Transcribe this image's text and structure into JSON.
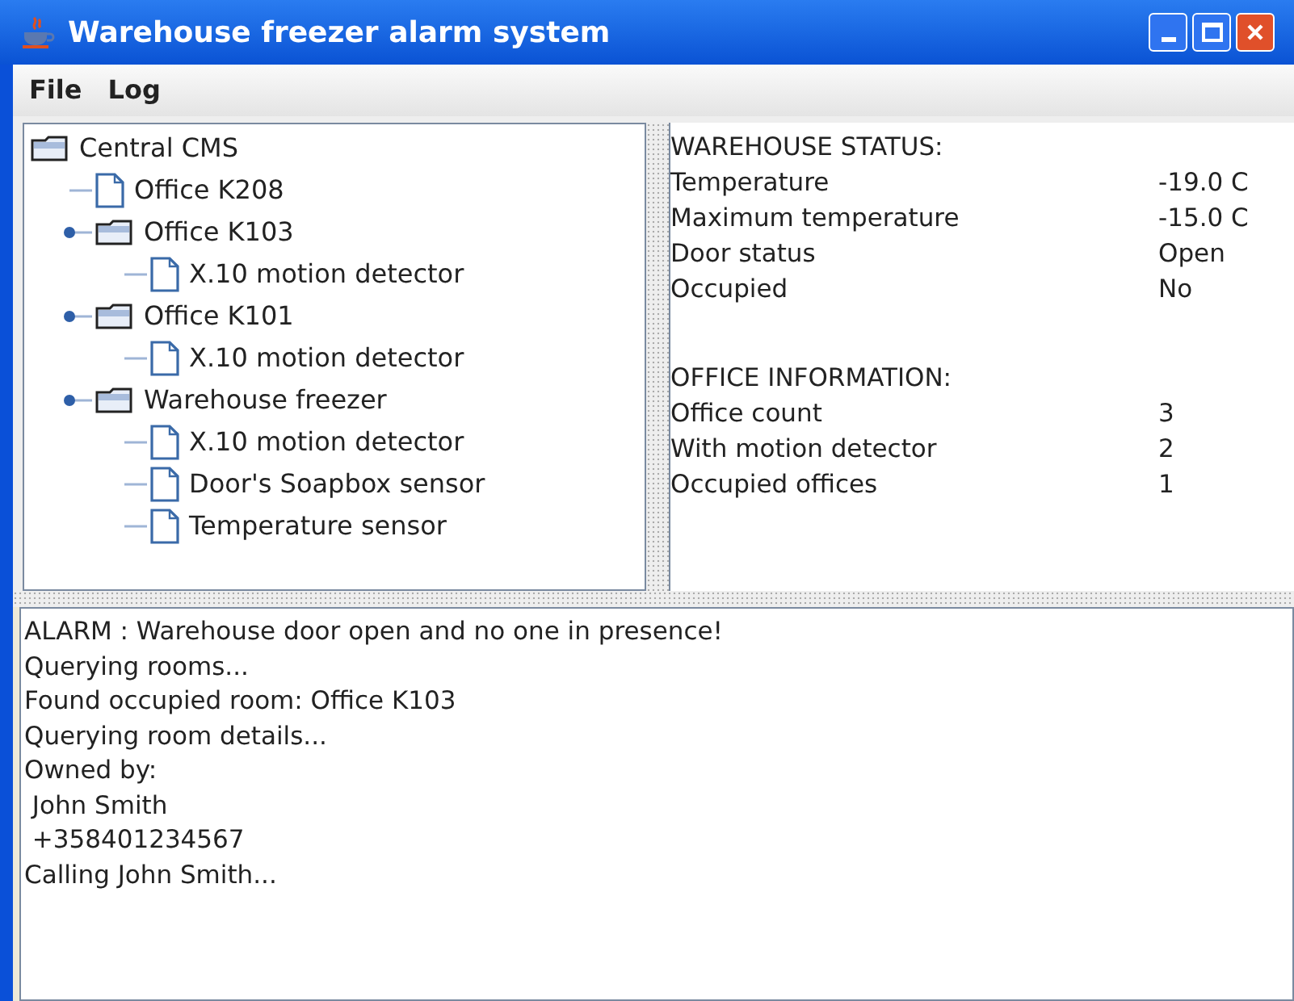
{
  "window": {
    "title": "Warehouse freezer alarm system"
  },
  "menu": [
    "File",
    "Log"
  ],
  "tree": [
    {
      "label": "Central CMS",
      "kind": "folder",
      "children": [
        {
          "label": "Office K208",
          "kind": "file"
        },
        {
          "label": "Office K103",
          "kind": "folder",
          "children": [
            {
              "label": "X.10 motion detector",
              "kind": "file"
            }
          ]
        },
        {
          "label": "Office K101",
          "kind": "folder",
          "children": [
            {
              "label": "X.10 motion detector",
              "kind": "file"
            }
          ]
        },
        {
          "label": "Warehouse freezer",
          "kind": "folder",
          "children": [
            {
              "label": "X.10 motion detector",
              "kind": "file"
            },
            {
              "label": "Door's Soapbox sensor",
              "kind": "file"
            },
            {
              "label": "Temperature sensor",
              "kind": "file"
            }
          ]
        }
      ]
    }
  ],
  "status": [
    {
      "heading": "WAREHOUSE STATUS:",
      "rows": [
        {
          "label": "Temperature",
          "value": "-19.0 C"
        },
        {
          "label": "Maximum temperature",
          "value": "-15.0 C"
        },
        {
          "label": "Door status",
          "value": "Open"
        },
        {
          "label": "Occupied",
          "value": "No"
        }
      ]
    },
    {
      "heading": "OFFICE INFORMATION:",
      "rows": [
        {
          "label": "Office count",
          "value": "3"
        },
        {
          "label": "With motion detector",
          "value": "2"
        },
        {
          "label": "Occupied offices",
          "value": "1"
        }
      ]
    }
  ],
  "log": [
    "ALARM : Warehouse door open and no one in presence!",
    "Querying rooms...",
    "Found occupied room: Office K103",
    "Querying room details...",
    "Owned by:",
    " John Smith",
    " +358401234567",
    "Calling John Smith..."
  ]
}
